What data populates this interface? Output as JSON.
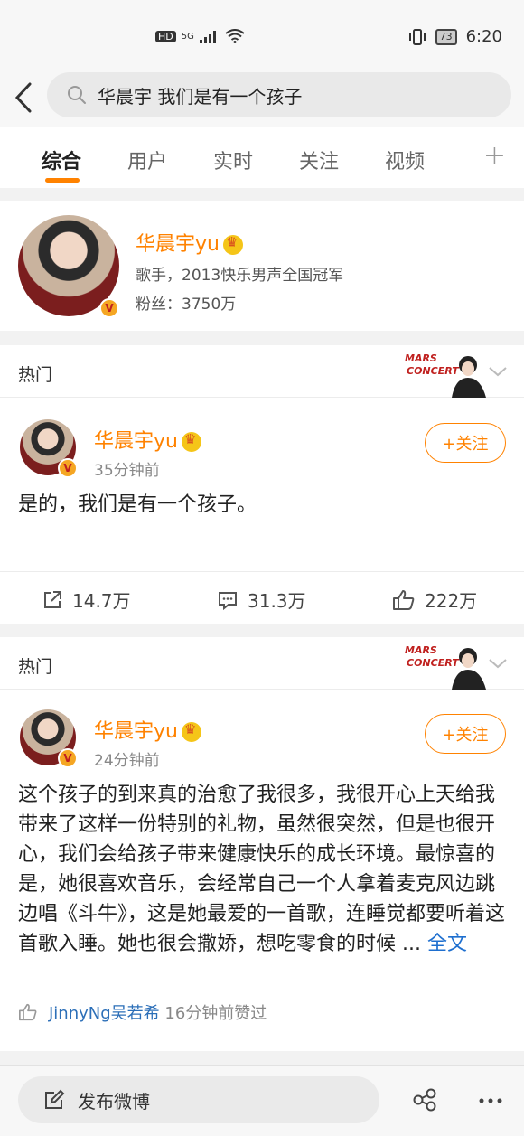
{
  "status_bar": {
    "network_label": "HD",
    "signal_label": "5G",
    "battery": "73",
    "time": "6:20"
  },
  "search": {
    "query": "华晨宇 我们是有一个孩子"
  },
  "tabs": [
    {
      "label": "综合",
      "active": true
    },
    {
      "label": "用户",
      "active": false
    },
    {
      "label": "实时",
      "active": false
    },
    {
      "label": "关注",
      "active": false
    },
    {
      "label": "视频",
      "active": false
    }
  ],
  "tabs_more": "+",
  "user_card": {
    "name": "华晨宇yu",
    "desc": "歌手，2013快乐男声全国冠军",
    "fans": "粉丝：3750万",
    "verified_badge": "V"
  },
  "posts": [
    {
      "section_label": "热门",
      "author": "华晨宇yu",
      "time": "35分钟前",
      "follow_label": "+关注",
      "text": "是的，我们是有一个孩子。",
      "reposts": "14.7万",
      "comments": "31.3万",
      "likes": "222万"
    },
    {
      "section_label": "热门",
      "author": "华晨宇yu",
      "time": "24分钟前",
      "follow_label": "+关注",
      "text": "这个孩子的到来真的治愈了我很多，我很开心上天给我带来了这样一份特别的礼物，虽然很突然，但是也很开心，我们会给孩子带来健康快乐的成长环境。最惊喜的是，她很喜欢音乐，会经常自己一个人拿着麦克风边跳边唱《斗牛》，这是她最爱的一首歌，连睡觉都要听着这首歌入睡。她也很会撒娇，想吃零食的时候 ...",
      "more_link": "全文",
      "liker_name": "JinnyNg吴若希",
      "liker_suffix": "16分钟前赞过"
    }
  ],
  "bottom_bar": {
    "compose_label": "发布微博"
  },
  "colors": {
    "accent": "#ff8200",
    "link": "#1e6fcf"
  }
}
